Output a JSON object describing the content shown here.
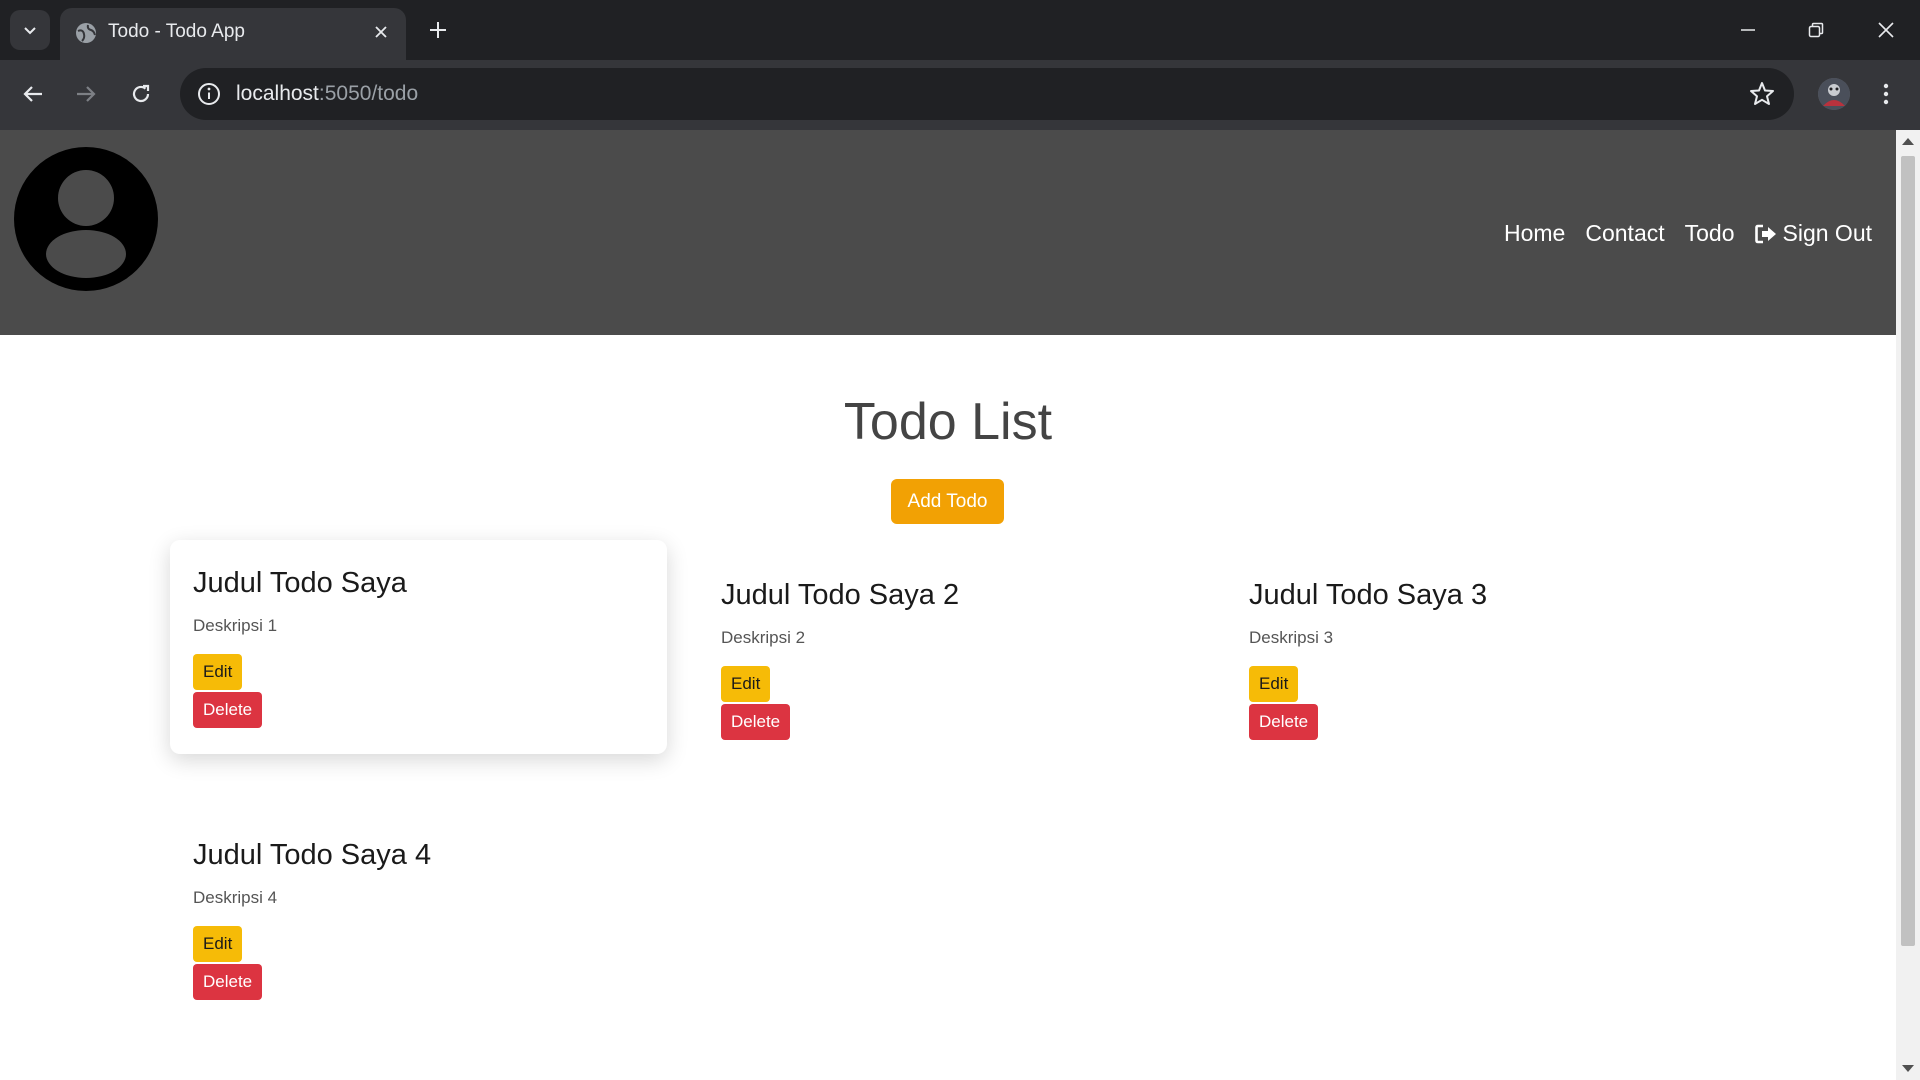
{
  "browser": {
    "tab_title": "Todo - Todo App",
    "url_host": "localhost",
    "url_path": ":5050/todo"
  },
  "nav": {
    "home": "Home",
    "contact": "Contact",
    "todo": "Todo",
    "sign_out": "Sign Out"
  },
  "page": {
    "title": "Todo List",
    "add_button": "Add Todo"
  },
  "todos": [
    {
      "title": "Judul Todo Saya",
      "description": "Deskripsi 1",
      "edit": "Edit",
      "delete": "Delete"
    },
    {
      "title": "Judul Todo Saya 2",
      "description": "Deskripsi 2",
      "edit": "Edit",
      "delete": "Delete"
    },
    {
      "title": "Judul Todo Saya 3",
      "description": "Deskripsi 3",
      "edit": "Edit",
      "delete": "Delete"
    },
    {
      "title": "Judul Todo Saya 4",
      "description": "Deskripsi 4",
      "edit": "Edit",
      "delete": "Delete"
    }
  ],
  "colors": {
    "header_bg": "#4b4b4b",
    "add_button": "#f2a104",
    "edit_button": "#f6bb07",
    "delete_button": "#dc3441"
  }
}
